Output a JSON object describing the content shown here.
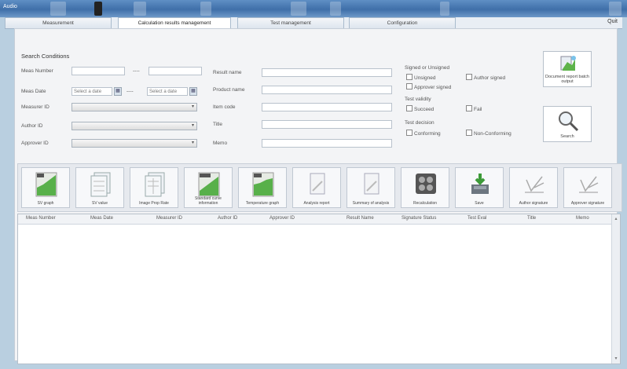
{
  "window": {
    "app_title": "Audio"
  },
  "tabs": [
    {
      "label": "Measurement"
    },
    {
      "label": "Calculation results management"
    },
    {
      "label": "Test management"
    },
    {
      "label": "Configuration"
    }
  ],
  "quit_label": "Quit",
  "search": {
    "title": "Search Conditions",
    "meas_number_label": "Meas Number",
    "meas_number_sep": "----",
    "meas_date_label": "Meas Date",
    "date_placeholder": "Select a date",
    "date_sep": "----",
    "measurer_label": "Measurer ID",
    "author_label": "Author ID",
    "approver_label": "Approver ID",
    "result_name_label": "Result name",
    "product_name_label": "Product name",
    "item_code_label": "Item code",
    "title_label": "Title",
    "memo_label": "Memo"
  },
  "signed": {
    "title": "Signed or Unsigned",
    "unsigned": "Unsigned",
    "author_signed": "Author signed",
    "approver_signed": "Approver signed"
  },
  "validity": {
    "title": "Test validity",
    "succeed": "Succeed",
    "fail": "Fail"
  },
  "decision": {
    "title": "Test decision",
    "conforming": "Conforming",
    "non_conforming": "Non-Conforming"
  },
  "buttons": {
    "doc_report": "Document report batch output",
    "search": "Search"
  },
  "toolbar": [
    {
      "label": "SV graph"
    },
    {
      "label": "SV value"
    },
    {
      "label": "Image Prop Rate"
    },
    {
      "label": "Standard curve information"
    },
    {
      "label": "Temperature graph"
    },
    {
      "label": "Analysis report"
    },
    {
      "label": "Summary of analysis"
    },
    {
      "label": "Recalculation"
    },
    {
      "label": "Save"
    },
    {
      "label": "Author signature"
    },
    {
      "label": "Approver signature"
    }
  ],
  "grid": {
    "columns": [
      "Meas Number",
      "Meas Date",
      "Measurer ID",
      "Author ID",
      "Approver ID",
      "Result Name",
      "Signature Status",
      "Test Eval",
      "Title",
      "Memo"
    ]
  }
}
